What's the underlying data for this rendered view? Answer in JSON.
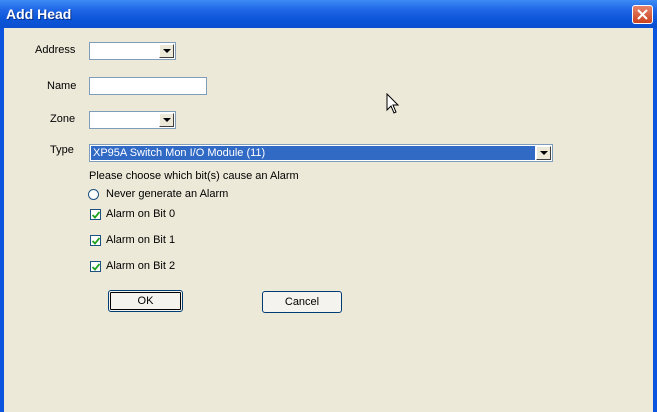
{
  "window": {
    "title": "Add Head"
  },
  "fields": {
    "address_label": "Address",
    "name_label": "Name",
    "zone_label": "Zone",
    "type_label": "Type",
    "address_value": "",
    "name_value": "",
    "zone_value": "",
    "type_value": "XP95A Switch Mon I/O Module (11)"
  },
  "alarm": {
    "prompt": "Please choose which bit(s) cause an Alarm",
    "never_label": "Never generate an Alarm",
    "never_selected": false,
    "bits": [
      {
        "label": "Alarm on Bit 0",
        "checked": true
      },
      {
        "label": "Alarm on Bit 1",
        "checked": true
      },
      {
        "label": "Alarm on Bit 2",
        "checked": true
      }
    ]
  },
  "buttons": {
    "ok": "OK",
    "cancel": "Cancel"
  },
  "icons": {
    "close": "close-icon",
    "dropdown": "chevron-down-icon",
    "check": "checkmark-icon",
    "cursor": "mouse-pointer-icon"
  }
}
